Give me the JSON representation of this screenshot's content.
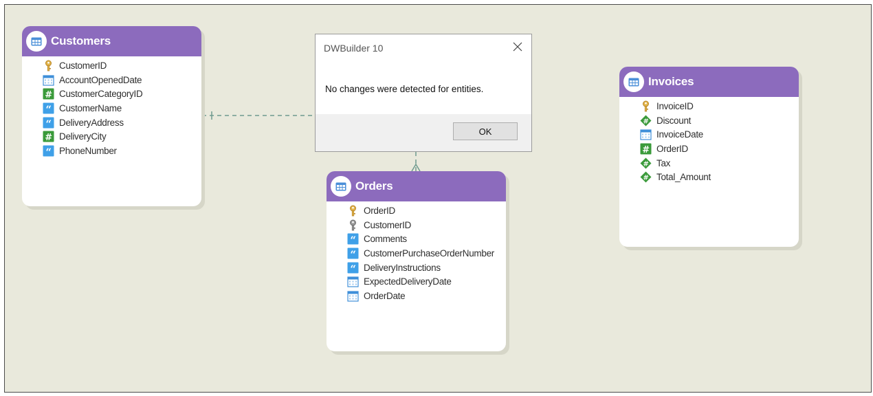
{
  "colors": {
    "canvas": "#e9e9dc",
    "entity_header": "#8c6bbd",
    "link": "#6f9b8f"
  },
  "entities": {
    "customers": {
      "name": "Customers",
      "fields": [
        {
          "name": "CustomerID",
          "icon": "key-icon"
        },
        {
          "name": "AccountOpenedDate",
          "icon": "calendar-icon"
        },
        {
          "name": "CustomerCategoryID",
          "icon": "hash-icon"
        },
        {
          "name": "CustomerName",
          "icon": "quote-icon"
        },
        {
          "name": "DeliveryAddress",
          "icon": "quote-icon"
        },
        {
          "name": "DeliveryCity",
          "icon": "hash-icon"
        },
        {
          "name": "PhoneNumber",
          "icon": "quote-icon"
        }
      ]
    },
    "orders": {
      "name": "Orders",
      "fields": [
        {
          "name": "OrderID",
          "icon": "key-icon"
        },
        {
          "name": "CustomerID",
          "icon": "foreign-key-icon"
        },
        {
          "name": "Comments",
          "icon": "quote-icon"
        },
        {
          "name": "CustomerPurchaseOrderNumber",
          "icon": "quote-icon"
        },
        {
          "name": "DeliveryInstructions",
          "icon": "quote-icon"
        },
        {
          "name": "ExpectedDeliveryDate",
          "icon": "calendar-icon"
        },
        {
          "name": "OrderDate",
          "icon": "calendar-icon"
        }
      ]
    },
    "invoices": {
      "name": "Invoices",
      "fields": [
        {
          "name": "InvoiceID",
          "icon": "key-icon"
        },
        {
          "name": "Discount",
          "icon": "decimal-icon"
        },
        {
          "name": "InvoiceDate",
          "icon": "calendar-icon"
        },
        {
          "name": "OrderID",
          "icon": "hash-icon"
        },
        {
          "name": "Tax",
          "icon": "decimal-icon"
        },
        {
          "name": "Total_Amount",
          "icon": "decimal-icon"
        }
      ]
    }
  },
  "dialog": {
    "title": "DWBuilder 10",
    "message": "No changes were detected for entities.",
    "ok_label": "OK"
  }
}
